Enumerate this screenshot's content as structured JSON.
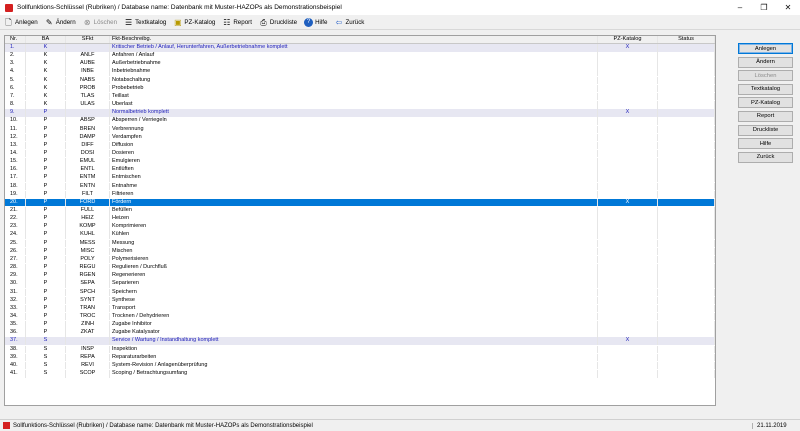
{
  "window": {
    "title": "Sollfunktions-Schlüssel (Rubriken) / Database name: Datenbank mit Muster-HAZOPs als Demonstrationsbeispiel"
  },
  "toolbar": {
    "items": [
      {
        "label": "Anlegen",
        "icon": "new-doc-icon",
        "enabled": true
      },
      {
        "label": "Ändern",
        "icon": "edit-icon",
        "enabled": true
      },
      {
        "label": "Löschen",
        "icon": "delete-icon",
        "enabled": false
      },
      {
        "label": "Textkatalog",
        "icon": "catalog-icon",
        "enabled": true
      },
      {
        "label": "PZ-Katalog",
        "icon": "pz-catalog-icon",
        "enabled": true
      },
      {
        "label": "Report",
        "icon": "report-icon",
        "enabled": true
      },
      {
        "label": "Druckliste",
        "icon": "print-icon",
        "enabled": true
      },
      {
        "label": "Hilfe",
        "icon": "help-icon",
        "enabled": true
      },
      {
        "label": "Zurück",
        "icon": "back-arrow-icon",
        "enabled": true
      }
    ]
  },
  "grid": {
    "columns": [
      "Nr.",
      "BA",
      "SFkt",
      "Fkt-Beschreibg.",
      "PZ-Katalog",
      "Status"
    ],
    "rows": [
      {
        "nr": "1.",
        "ba": "K",
        "sfkt": "",
        "desc": "Kritischer Betrieb / Anlauf, Herunterfahren, Außerbetriebnahme  komplett",
        "pz": "X",
        "status": "",
        "type": "group"
      },
      {
        "nr": "2.",
        "ba": "K",
        "sfkt": "ANLF",
        "desc": "Anfahren / Anlauf",
        "pz": "",
        "status": "",
        "type": "normal"
      },
      {
        "nr": "3.",
        "ba": "K",
        "sfkt": "AUBE",
        "desc": "Außerbetriebnahme",
        "pz": "",
        "status": "",
        "type": "normal"
      },
      {
        "nr": "4.",
        "ba": "K",
        "sfkt": "INBE",
        "desc": "Inbetriebnahme",
        "pz": "",
        "status": "",
        "type": "normal"
      },
      {
        "nr": "5.",
        "ba": "K",
        "sfkt": "NABS",
        "desc": "Notabschaltung",
        "pz": "",
        "status": "",
        "type": "normal"
      },
      {
        "nr": "6.",
        "ba": "K",
        "sfkt": "PROB",
        "desc": "Probebetrieb",
        "pz": "",
        "status": "",
        "type": "normal"
      },
      {
        "nr": "7.",
        "ba": "K",
        "sfkt": "TLAS",
        "desc": "Teillast",
        "pz": "",
        "status": "",
        "type": "normal"
      },
      {
        "nr": "8.",
        "ba": "K",
        "sfkt": "ÜLAS",
        "desc": "Überlast",
        "pz": "",
        "status": "",
        "type": "normal"
      },
      {
        "nr": "9.",
        "ba": "P",
        "sfkt": "",
        "desc": "Normalbetrieb  komplett",
        "pz": "X",
        "status": "",
        "type": "group"
      },
      {
        "nr": "10.",
        "ba": "P",
        "sfkt": "ABSP",
        "desc": "Absperren / Verriegeln",
        "pz": "",
        "status": "",
        "type": "normal"
      },
      {
        "nr": "11.",
        "ba": "P",
        "sfkt": "BREN",
        "desc": "Verbrennung",
        "pz": "",
        "status": "",
        "type": "normal"
      },
      {
        "nr": "12.",
        "ba": "P",
        "sfkt": "DAMP",
        "desc": "Verdampfen",
        "pz": "",
        "status": "",
        "type": "normal"
      },
      {
        "nr": "13.",
        "ba": "P",
        "sfkt": "DIFF",
        "desc": "Diffusion",
        "pz": "",
        "status": "",
        "type": "normal"
      },
      {
        "nr": "14.",
        "ba": "P",
        "sfkt": "DOSI",
        "desc": "Dosieren",
        "pz": "",
        "status": "",
        "type": "normal"
      },
      {
        "nr": "15.",
        "ba": "P",
        "sfkt": "EMUL",
        "desc": "Emulgieren",
        "pz": "",
        "status": "",
        "type": "normal"
      },
      {
        "nr": "16.",
        "ba": "P",
        "sfkt": "ENTL",
        "desc": "Entlüften",
        "pz": "",
        "status": "",
        "type": "normal"
      },
      {
        "nr": "17.",
        "ba": "P",
        "sfkt": "ENTM",
        "desc": "Entmischen",
        "pz": "",
        "status": "",
        "type": "normal"
      },
      {
        "nr": "18.",
        "ba": "P",
        "sfkt": "ENTN",
        "desc": "Entnahme",
        "pz": "",
        "status": "",
        "type": "normal"
      },
      {
        "nr": "19.",
        "ba": "P",
        "sfkt": "FILT",
        "desc": "Filtrieren",
        "pz": "",
        "status": "",
        "type": "normal"
      },
      {
        "nr": "20.",
        "ba": "P",
        "sfkt": "FÖRD",
        "desc": "Fördern",
        "pz": "X",
        "status": "",
        "type": "selected"
      },
      {
        "nr": "21.",
        "ba": "P",
        "sfkt": "FÜLL",
        "desc": "Befüllen",
        "pz": "",
        "status": "",
        "type": "normal"
      },
      {
        "nr": "22.",
        "ba": "P",
        "sfkt": "HEIZ",
        "desc": "Heizen",
        "pz": "",
        "status": "",
        "type": "normal"
      },
      {
        "nr": "23.",
        "ba": "P",
        "sfkt": "KOMP",
        "desc": "Komprimieren",
        "pz": "",
        "status": "",
        "type": "normal"
      },
      {
        "nr": "24.",
        "ba": "P",
        "sfkt": "KÜHL",
        "desc": "Kühlen",
        "pz": "",
        "status": "",
        "type": "normal"
      },
      {
        "nr": "25.",
        "ba": "P",
        "sfkt": "MESS",
        "desc": "Messung",
        "pz": "",
        "status": "",
        "type": "normal"
      },
      {
        "nr": "26.",
        "ba": "P",
        "sfkt": "MISC",
        "desc": "Mischen",
        "pz": "",
        "status": "",
        "type": "normal"
      },
      {
        "nr": "27.",
        "ba": "P",
        "sfkt": "POLY",
        "desc": "Polymerisieren",
        "pz": "",
        "status": "",
        "type": "normal"
      },
      {
        "nr": "28.",
        "ba": "P",
        "sfkt": "REGU",
        "desc": "Regulieren / Durchfluß",
        "pz": "",
        "status": "",
        "type": "normal"
      },
      {
        "nr": "29.",
        "ba": "P",
        "sfkt": "RGEN",
        "desc": "Regenerieren",
        "pz": "",
        "status": "",
        "type": "normal"
      },
      {
        "nr": "30.",
        "ba": "P",
        "sfkt": "SEPA",
        "desc": "Separieren",
        "pz": "",
        "status": "",
        "type": "normal"
      },
      {
        "nr": "31.",
        "ba": "P",
        "sfkt": "SPCH",
        "desc": "Speichern",
        "pz": "",
        "status": "",
        "type": "normal"
      },
      {
        "nr": "32.",
        "ba": "P",
        "sfkt": "SYNT",
        "desc": "Synthese",
        "pz": "",
        "status": "",
        "type": "normal"
      },
      {
        "nr": "33.",
        "ba": "P",
        "sfkt": "TRAN",
        "desc": "Transport",
        "pz": "",
        "status": "",
        "type": "normal"
      },
      {
        "nr": "34.",
        "ba": "P",
        "sfkt": "TROC",
        "desc": "Trocknen / Dehydrieren",
        "pz": "",
        "status": "",
        "type": "normal"
      },
      {
        "nr": "35.",
        "ba": "P",
        "sfkt": "ZINH",
        "desc": "Zugabe Inhibitor",
        "pz": "",
        "status": "",
        "type": "normal"
      },
      {
        "nr": "36.",
        "ba": "P",
        "sfkt": "ZKAT",
        "desc": "Zugabe Katalysator",
        "pz": "",
        "status": "",
        "type": "normal"
      },
      {
        "nr": "37.",
        "ba": "S",
        "sfkt": "",
        "desc": "Service / Wartung / Instandhaltung  komplett",
        "pz": "X",
        "status": "",
        "type": "group"
      },
      {
        "nr": "38.",
        "ba": "S",
        "sfkt": "INSP",
        "desc": "Inspektion",
        "pz": "",
        "status": "",
        "type": "normal"
      },
      {
        "nr": "39.",
        "ba": "S",
        "sfkt": "REPA",
        "desc": "Reparaturarbeiten",
        "pz": "",
        "status": "",
        "type": "normal"
      },
      {
        "nr": "40.",
        "ba": "S",
        "sfkt": "REVI",
        "desc": "System-Revision / Anlagenüberprüfung",
        "pz": "",
        "status": "",
        "type": "normal"
      },
      {
        "nr": "41.",
        "ba": "S",
        "sfkt": "SCOP",
        "desc": "Scoping / Betrachtungsumfang",
        "pz": "",
        "status": "",
        "type": "normal"
      }
    ]
  },
  "side_buttons": [
    {
      "label": "Anlegen",
      "enabled": true,
      "default": true
    },
    {
      "label": "Ändern",
      "enabled": true,
      "default": false
    },
    {
      "label": "Löschen",
      "enabled": false,
      "default": false
    },
    {
      "label": "Textkatalog",
      "enabled": true,
      "default": false
    },
    {
      "label": "PZ-Katalog",
      "enabled": true,
      "default": false
    },
    {
      "label": "Report",
      "enabled": true,
      "default": false
    },
    {
      "label": "Druckliste",
      "enabled": true,
      "default": false
    },
    {
      "label": "Hilfe",
      "enabled": true,
      "default": false
    },
    {
      "label": "Zurück",
      "enabled": true,
      "default": false
    }
  ],
  "statusbar": {
    "text": "Sollfunktions-Schlüssel (Rubriken) / Database name: Datenbank mit Muster-HAZOPs als Demonstrationsbeispiel",
    "date": "21.11.2019"
  },
  "colors": {
    "selection": "#0078d7",
    "group_text": "#1a1ab8",
    "group_bg": "#e7e7f2",
    "app_icon": "#d42020"
  }
}
